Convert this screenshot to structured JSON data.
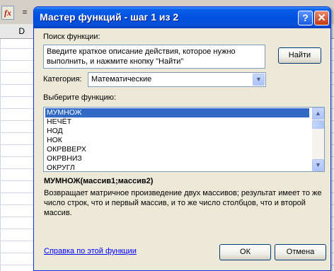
{
  "excel": {
    "fx_label": "fx",
    "equals_label": "=",
    "column_header": "D"
  },
  "dialog": {
    "title": "Мастер функций - шаг 1 из 2",
    "help_button": "?",
    "close_button": "✕",
    "search_label": "Поиск функции:",
    "search_value": "Введите краткое описание действия, которое нужно выполнить, и нажмите кнопку \"Найти\"",
    "find_button": "Найти",
    "category_label": "Категория:",
    "category_value": "Математические",
    "select_label": "Выберите функцию:",
    "functions": [
      "МУМНОЖ",
      "НЕЧЁТ",
      "НОД",
      "НОК",
      "ОКРВВЕРХ",
      "ОКРВНИЗ",
      "ОКРУГЛ"
    ],
    "selected_function": "МУМНОЖ",
    "signature": "МУМНОЖ(массив1;массив2)",
    "description": "Возвращает матричное произведение двух массивов; результат имеет то же число строк, что и первый массив, и то же число столбцов, что и второй массив.",
    "help_link": "Справка по этой функции",
    "ok_button": "ОК",
    "cancel_button": "Отмена"
  },
  "icons": {
    "combo_arrow": "chevron-down-icon",
    "scroll_up": "chevron-up-icon",
    "scroll_down": "chevron-down-icon"
  },
  "colors": {
    "title_bar": "#0050e0",
    "selection": "#316ac5",
    "link": "#0000ff",
    "dialog_bg": "#ece9d8"
  }
}
